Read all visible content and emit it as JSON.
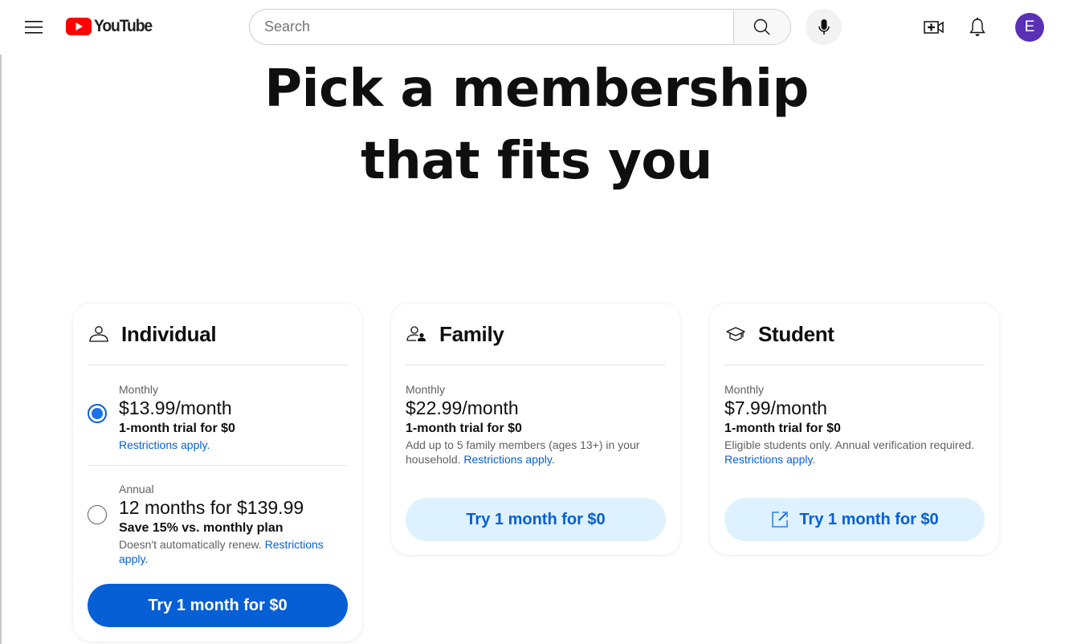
{
  "header": {
    "logo_text": "YouTube",
    "search_placeholder": "Search",
    "search_value": "",
    "avatar_initial": "E",
    "icons": {
      "menu": "hamburger-menu-icon",
      "search": "search-icon",
      "mic": "microphone-icon",
      "create": "create-video-icon",
      "notifications": "bell-icon"
    }
  },
  "page": {
    "title_line1": "Pick a membership",
    "title_line2": "that fits you"
  },
  "colors": {
    "brand_red": "#ff0000",
    "primary_blue": "#065fd4",
    "light_blue": "#def1ff",
    "avatar_purple": "#5a30b5"
  },
  "plans": [
    {
      "name": "Individual",
      "icon": "person-icon",
      "options": [
        {
          "period": "Monthly",
          "price": "$13.99/month",
          "highlight": "1-month trial for $0",
          "description": "",
          "link": "Restrictions apply.",
          "selected": true
        },
        {
          "period": "Annual",
          "price": "12 months for $139.99",
          "highlight": "Save 15% vs. monthly plan",
          "description": "Doesn't automatically renew.",
          "link": "Restrictions apply.",
          "selected": false
        }
      ],
      "cta": "Try 1 month for $0"
    },
    {
      "name": "Family",
      "icon": "family-icon",
      "options": [
        {
          "period": "Monthly",
          "price": "$22.99/month",
          "highlight": "1-month trial for $0",
          "description": "Add up to 5 family members (ages 13+) in your household.",
          "link": "Restrictions apply."
        }
      ],
      "cta": "Try 1 month for $0"
    },
    {
      "name": "Student",
      "icon": "graduation-cap-icon",
      "options": [
        {
          "period": "Monthly",
          "price": "$7.99/month",
          "highlight": "1-month trial for $0",
          "description": "Eligible students only. Annual verification required.",
          "link": "Restrictions apply."
        }
      ],
      "cta": "Try 1 month for $0",
      "cta_icon": "open-external-icon"
    }
  ]
}
